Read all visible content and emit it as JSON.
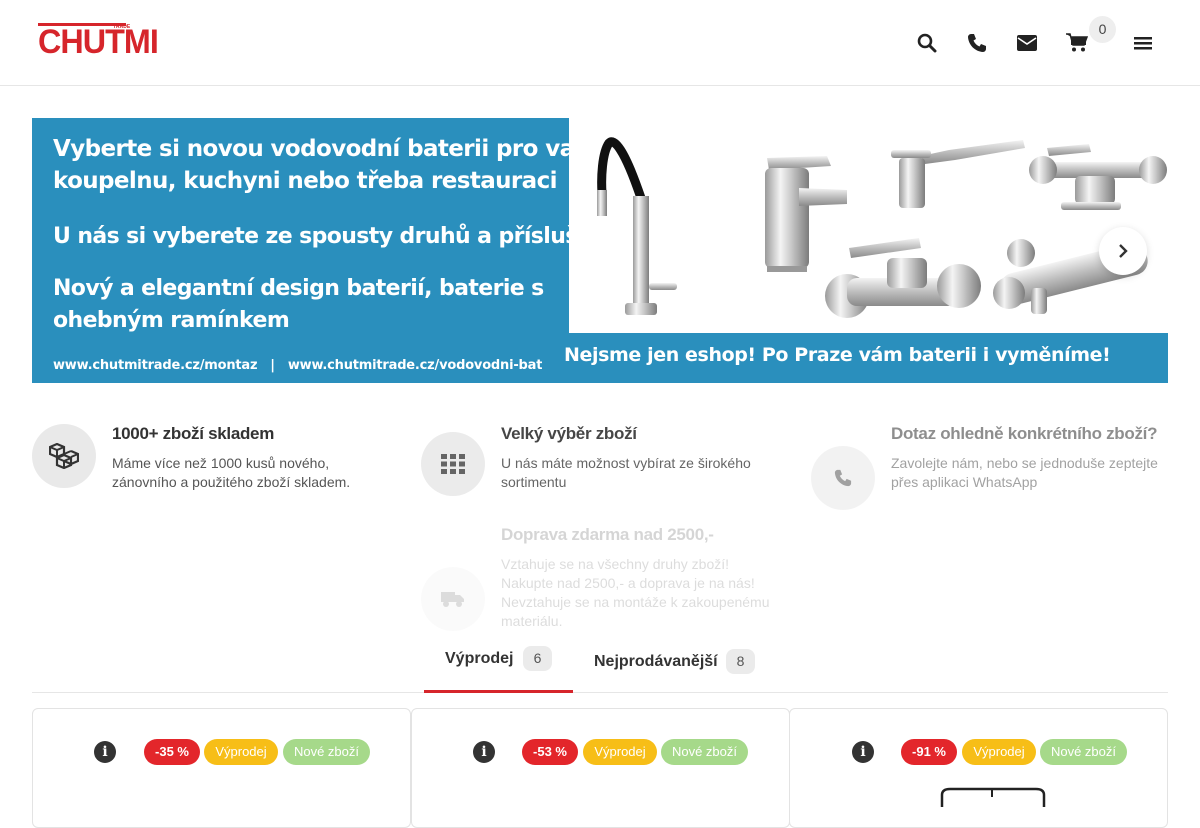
{
  "header": {
    "logo_text": "CHUTMI",
    "logo_sub": "TRADE",
    "cart_count": "0",
    "icons": [
      "search-icon",
      "phone-icon",
      "envelope-icon",
      "cart-icon",
      "menu-icon"
    ]
  },
  "banner": {
    "line1": "Vyberte si novou vodovodní baterii pro vaší",
    "line2": "koupelnu, kuchyni nebo třeba restauraci",
    "line3": "U nás si vyberete ze spousty druhů a příslušenství",
    "line4": "Nový a elegantní design baterií, baterie s",
    "line5": "ohebným ramínkem",
    "urls": "www.chutmitrade.cz/montaz   |   www.chutmitrade.cz/vodovodni-baterie",
    "strip": "Nejsme jen eshop! Po Praze vám baterii i vyměníme!"
  },
  "features": [
    {
      "title": "1000+ zboží skladem",
      "text": "Máme více než 1000 kusů nového, zánovního a použitého zboží skladem.",
      "icon": "cubes-icon"
    },
    {
      "title": "Velký výběr zboží",
      "text": "U nás máte možnost vybírat ze širokého sortimentu",
      "icon": "grid-icon"
    },
    {
      "title": "Dotaz ohledně konkrétního zboží?",
      "text": "Zavolejte nám, nebo se jednoduše zeptejte přes aplikaci WhatsApp",
      "icon": "phone-icon"
    },
    {
      "title": "Doprava zdarma nad 2500,-",
      "text": "Vztahuje se na všechny druhy zboží! Nakupte nad 2500,- a doprava je na nás! Nevztahuje se na montáže k zakoupenému materiálu.",
      "icon": "truck-icon"
    }
  ],
  "tabs": [
    {
      "label": "Výprodej",
      "count": "6",
      "active": true
    },
    {
      "label": "Nejprodávanější",
      "count": "8",
      "active": false
    }
  ],
  "products": [
    {
      "discount": "-35 %",
      "sale": "Výprodej",
      "new": "Nové zboží"
    },
    {
      "discount": "-53 %",
      "sale": "Výprodej",
      "new": "Nové zboží"
    },
    {
      "discount": "-91 %",
      "sale": "Výprodej",
      "new": "Nové zboží"
    }
  ],
  "colors": {
    "brand_red": "#d6252b",
    "banner_blue": "#2a8fbd",
    "badge_discount": "#e3262b",
    "badge_sale": "#f7be17",
    "badge_new": "#a6d98a"
  }
}
